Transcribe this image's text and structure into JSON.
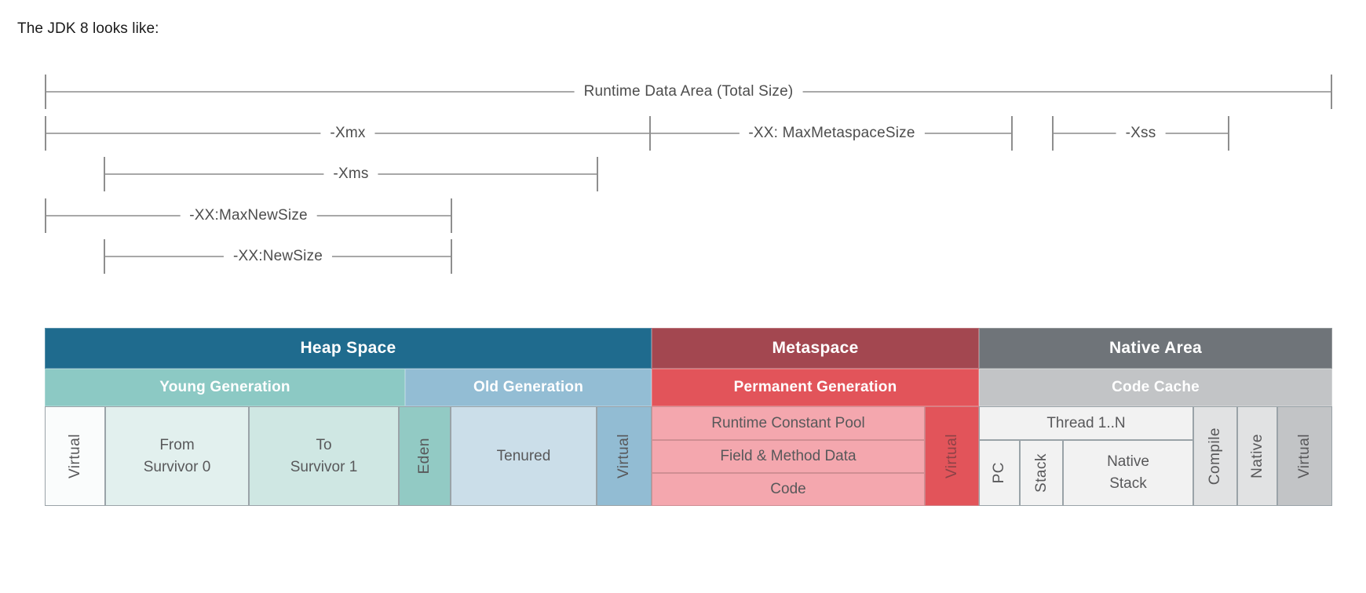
{
  "caption": "The JDK 8 looks like:",
  "rulers": [
    {
      "label": "Runtime Data Area (Total Size)",
      "name": "ruler-runtime-data-area"
    },
    {
      "label": "-Xmx",
      "name": "ruler-xmx"
    },
    {
      "label": "-XX: MaxMetaspaceSize",
      "name": "ruler-max-metaspace-size"
    },
    {
      "label": "-Xss",
      "name": "ruler-xss"
    },
    {
      "label": "-Xms",
      "name": "ruler-xms"
    },
    {
      "label": "-XX:MaxNewSize",
      "name": "ruler-max-new-size"
    },
    {
      "label": "-XX:NewSize",
      "name": "ruler-new-size"
    }
  ],
  "memory_map": {
    "band1": [
      {
        "label": "Heap Space",
        "color": "#1f6b8e"
      },
      {
        "label": "Metaspace",
        "color": "#a34750"
      },
      {
        "label": "Native Area",
        "color": "#6f7479"
      }
    ],
    "band2": [
      {
        "label": "Young Generation",
        "color": "#8cc9c4"
      },
      {
        "label": "Old Generation",
        "color": "#93bdd4"
      },
      {
        "label": "Permanent Generation",
        "color": "#e2545a"
      },
      {
        "label": "Code Cache",
        "color": "#c2c4c6"
      }
    ],
    "heap_cells": [
      {
        "label": "Virtual",
        "orientation": "vertical",
        "color": "#fafcfc"
      },
      {
        "label": "From\nSurvivor 0",
        "orientation": "horizontal",
        "color": "#e2f0ee"
      },
      {
        "label": "To\nSurvivor 1",
        "orientation": "horizontal",
        "color": "#cfe7e3"
      },
      {
        "label": "Eden",
        "orientation": "vertical",
        "color": "#92cac4"
      },
      {
        "label": "Tenured",
        "orientation": "horizontal",
        "color": "#cbdee9"
      },
      {
        "label": "Virtual",
        "orientation": "vertical",
        "color": "#92bcd3"
      }
    ],
    "metaspace_cells": [
      {
        "label": "Runtime Constant Pool",
        "color": "#f4a7ae"
      },
      {
        "label": "Field & Method Data",
        "color": "#f4a7ae"
      },
      {
        "label": "Code",
        "color": "#f4a7ae"
      }
    ],
    "metaspace_virtual": {
      "label": "Virtual",
      "color": "#e2545a"
    },
    "native_thread_header": {
      "label": "Thread 1..N",
      "color": "#f2f2f2"
    },
    "native_cells": [
      {
        "label": "PC",
        "orientation": "vertical",
        "color": "#f2f2f2"
      },
      {
        "label": "Stack",
        "orientation": "vertical",
        "color": "#f2f2f2"
      },
      {
        "label": "Native\nStack",
        "orientation": "horizontal",
        "color": "#f2f2f2"
      },
      {
        "label": "Compile",
        "orientation": "vertical",
        "color": "#e1e2e3"
      },
      {
        "label": "Native",
        "orientation": "vertical",
        "color": "#e1e2e3"
      },
      {
        "label": "Virtual",
        "orientation": "vertical",
        "color": "#c2c4c6"
      }
    ]
  }
}
